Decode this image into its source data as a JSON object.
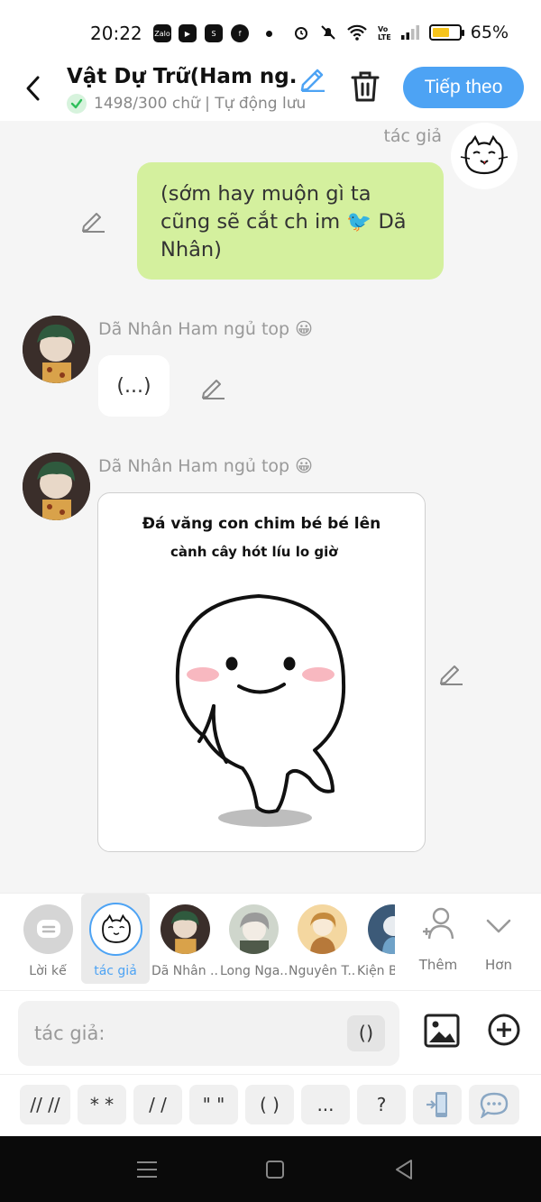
{
  "status": {
    "time": "20:22",
    "battery_text": "65%",
    "battery_level": 0.65,
    "app_icons": [
      "Zalo",
      "video-chat",
      "shopee",
      "facebook"
    ]
  },
  "header": {
    "title": "Vật Dự Trữ(Ham ng...",
    "subtitle": "1498/300 chữ | Tự động lưu",
    "next_label": "Tiếp theo"
  },
  "chat": {
    "author_label": "tác giả",
    "author_message": "(sớm hay muộn gì ta cũng sẽ cắt ch im 🐦 Dã Nhân)",
    "messages": [
      {
        "speaker": "Dã Nhân Ham ngủ top 😀",
        "text": "(...)"
      },
      {
        "speaker": "Dã Nhân Ham ngủ top 😀",
        "sticker_line1": "Đá văng con chim bé bé lên",
        "sticker_line2": "cành cây hót líu lo giờ"
      }
    ]
  },
  "characters": [
    {
      "label": "Lời kể"
    },
    {
      "label": "tác giả"
    },
    {
      "label": "Dã Nhân ..."
    },
    {
      "label": "Long Nga..."
    },
    {
      "label": "Nguyên T..."
    },
    {
      "label": "Kiện B"
    }
  ],
  "more_actions": {
    "add_label": "Thêm",
    "more_label": "Hơn"
  },
  "input": {
    "placeholder": "tác giả:",
    "paren_label": "()"
  },
  "quick_keys": [
    "// //",
    "* *",
    "/ /",
    "\" \"",
    "( )",
    "...",
    "?",
    "",
    ""
  ],
  "colors": {
    "accent": "#4da3f4",
    "author_bubble": "#d4f09e"
  }
}
